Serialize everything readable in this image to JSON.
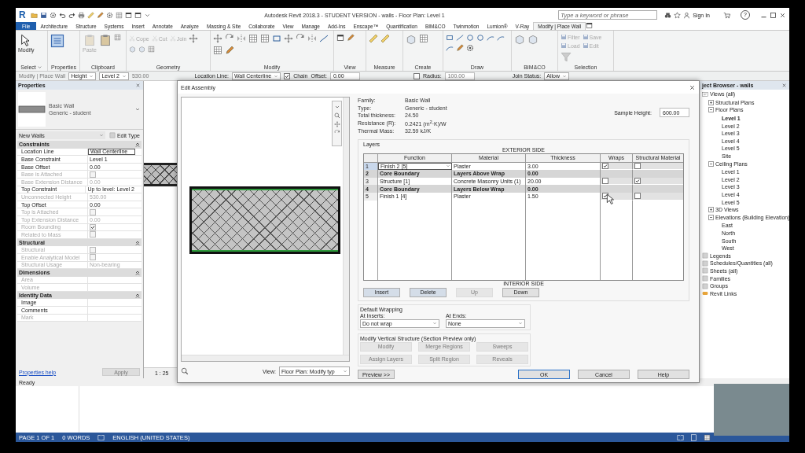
{
  "app": {
    "logo": "R",
    "title": "Autodesk Revit 2018.3 - STUDENT VERSION -   walls - Floor Plan: Level 1",
    "search": {
      "placeholder": "Type a keyword or phrase"
    },
    "sign_in": "Sign In",
    "help": "?"
  },
  "ribbon_tabs": [
    {
      "label": "File",
      "selected": false,
      "kind": "file"
    },
    {
      "label": "Architecture",
      "selected": false,
      "kind": "tab"
    },
    {
      "label": "Structure",
      "selected": false,
      "kind": "tab"
    },
    {
      "label": "Systems",
      "selected": false,
      "kind": "tab"
    },
    {
      "label": "Insert",
      "selected": false,
      "kind": "tab"
    },
    {
      "label": "Annotate",
      "selected": false,
      "kind": "tab"
    },
    {
      "label": "Analyze",
      "selected": false,
      "kind": "tab"
    },
    {
      "label": "Massing & Site",
      "selected": false,
      "kind": "tab"
    },
    {
      "label": "Collaborate",
      "selected": false,
      "kind": "tab"
    },
    {
      "label": "View",
      "selected": false,
      "kind": "tab"
    },
    {
      "label": "Manage",
      "selected": false,
      "kind": "tab"
    },
    {
      "label": "Add-Ins",
      "selected": false,
      "kind": "tab"
    },
    {
      "label": "Enscape™",
      "selected": false,
      "kind": "tab"
    },
    {
      "label": "Quantification",
      "selected": false,
      "kind": "tab"
    },
    {
      "label": "BIM&CO",
      "selected": false,
      "kind": "tab"
    },
    {
      "label": "Twinmotion",
      "selected": false,
      "kind": "tab"
    },
    {
      "label": "Lumion®",
      "selected": false,
      "kind": "tab"
    },
    {
      "label": "V-Ray",
      "selected": false,
      "kind": "tab"
    },
    {
      "label": "Modify | Place Wall",
      "selected": true,
      "kind": "tab"
    }
  ],
  "ribbon_panels": [
    {
      "label": "Select",
      "dropdown": true,
      "tools": [
        {
          "label": "Modify",
          "disabled": false
        }
      ]
    },
    {
      "label": "Properties",
      "dropdown": false
    },
    {
      "label": "Clipboard",
      "dropdown": false,
      "tools": [
        {
          "label": "Paste",
          "disabled": true
        }
      ]
    },
    {
      "label": "Geometry",
      "dropdown": false,
      "tools": [
        {
          "label": "Cope",
          "disabled": true
        },
        {
          "label": "Cut",
          "disabled": true
        },
        {
          "label": "Join",
          "disabled": true
        }
      ]
    },
    {
      "label": "Modify",
      "dropdown": false
    },
    {
      "label": "View",
      "dropdown": false
    },
    {
      "label": "Measure",
      "dropdown": false
    },
    {
      "label": "Create",
      "dropdown": false
    },
    {
      "label": "Draw",
      "dropdown": false
    },
    {
      "label": "BIM&CO",
      "dropdown": false
    },
    {
      "label": "Selection",
      "dropdown": false,
      "tools": [
        {
          "label": "Filter",
          "disabled": true
        },
        {
          "label": "Save",
          "disabled": true
        },
        {
          "label": "Load",
          "disabled": true
        },
        {
          "label": "Edit",
          "disabled": true
        }
      ]
    }
  ],
  "options_bar": {
    "mode": "Modify | Place Wall",
    "height_mode": "Height",
    "level": "Level 2",
    "height_value": "530.00",
    "location_label": "Location Line:",
    "location_value": "Wall Centerline",
    "chain": {
      "label": "Chain",
      "checked": true
    },
    "offset_label": "Offset:",
    "offset_value": "0.00",
    "radius": {
      "label": "Radius:",
      "checked": false,
      "value": "100.00"
    },
    "join_label": "Join Status:",
    "join_value": "Allow"
  },
  "properties": {
    "title": "Properties",
    "type_name": "Basic Wall",
    "type_sub": "Generic - student",
    "instance": "New Walls",
    "edit_type": "Edit Type",
    "groups": [
      {
        "title": "Constraints",
        "expanded": true,
        "rows": [
          {
            "label": "Location Line",
            "kind": "text",
            "value": "Wall Centerline",
            "disabled": false,
            "selected": true
          },
          {
            "label": "Base Constraint",
            "kind": "text",
            "value": "Level 1",
            "disabled": false,
            "selected": false
          },
          {
            "label": "Base Offset",
            "kind": "text",
            "value": "0.00",
            "disabled": false,
            "selected": false
          },
          {
            "label": "Base is Attached",
            "kind": "checkbox",
            "checked": false,
            "disabled": true,
            "selected": false
          },
          {
            "label": "Base Extension Distance",
            "kind": "text",
            "value": "0.00",
            "disabled": true,
            "selected": false
          },
          {
            "label": "Top Constraint",
            "kind": "text",
            "value": "Up to level: Level 2",
            "disabled": false,
            "selected": false
          },
          {
            "label": "Unconnected Height",
            "kind": "text",
            "value": "530.00",
            "disabled": true,
            "selected": false
          },
          {
            "label": "Top Offset",
            "kind": "text",
            "value": "0.00",
            "disabled": false,
            "selected": false
          },
          {
            "label": "Top is Attached",
            "kind": "checkbox",
            "checked": false,
            "disabled": true,
            "selected": false
          },
          {
            "label": "Top Extension Distance",
            "kind": "text",
            "value": "0.00",
            "disabled": true,
            "selected": false
          },
          {
            "label": "Room Bounding",
            "kind": "checkbox",
            "checked": true,
            "disabled": true,
            "selected": false
          },
          {
            "label": "Related to Mass",
            "kind": "checkbox",
            "checked": false,
            "disabled": true,
            "selected": false
          }
        ]
      },
      {
        "title": "Structural",
        "expanded": true,
        "rows": [
          {
            "label": "Structural",
            "kind": "checkbox",
            "checked": false,
            "disabled": true,
            "selected": false
          },
          {
            "label": "Enable Analytical Model",
            "kind": "checkbox",
            "checked": false,
            "disabled": true,
            "selected": false
          },
          {
            "label": "Structural Usage",
            "kind": "text",
            "value": "Non-bearing",
            "disabled": true,
            "selected": false
          }
        ]
      },
      {
        "title": "Dimensions",
        "expanded": true,
        "rows": [
          {
            "label": "Area",
            "kind": "text",
            "disabled": true,
            "selected": false
          },
          {
            "label": "Volume",
            "kind": "text",
            "disabled": true,
            "selected": false
          }
        ]
      },
      {
        "title": "Identity Data",
        "expanded": true,
        "rows": [
          {
            "label": "Image",
            "kind": "text",
            "disabled": false,
            "selected": false
          },
          {
            "label": "Comments",
            "kind": "text",
            "disabled": false,
            "selected": false
          },
          {
            "label": "Mark",
            "kind": "text",
            "disabled": true,
            "selected": false
          }
        ]
      }
    ],
    "help_link": "Properties help",
    "apply": {
      "label": "Apply",
      "disabled": true
    }
  },
  "view_bar": {
    "scale": "1 : 25"
  },
  "project_browser": {
    "title": "ject Browser - walls",
    "tree": [
      {
        "label": "Views (all)",
        "selected": false,
        "children": [
          {
            "label": "Structural Plans",
            "expanded": false,
            "selected": false
          },
          {
            "label": "Floor Plans",
            "expanded": true,
            "selected": false,
            "children": [
              {
                "label": "Level 1",
                "selected": true
              },
              {
                "label": "Level 2",
                "selected": false
              },
              {
                "label": "Level 3",
                "selected": false
              },
              {
                "label": "Level 4",
                "selected": false
              },
              {
                "label": "Level 5",
                "selected": false
              },
              {
                "label": "Site",
                "selected": false
              }
            ]
          },
          {
            "label": "Ceiling Plans",
            "expanded": true,
            "selected": false,
            "children": [
              {
                "label": "Level 1",
                "selected": false
              },
              {
                "label": "Level 2",
                "selected": false
              },
              {
                "label": "Level 3",
                "selected": false
              },
              {
                "label": "Level 4",
                "selected": false
              },
              {
                "label": "Level 5",
                "selected": false
              }
            ]
          },
          {
            "label": "3D Views",
            "expanded": false,
            "selected": false
          },
          {
            "label": "Elevations (Building Elevation)",
            "expanded": true,
            "selected": false,
            "children": [
              {
                "label": "East",
                "selected": false
              },
              {
                "label": "North",
                "selected": false
              },
              {
                "label": "South",
                "selected": false
              },
              {
                "label": "West",
                "selected": false
              }
            ]
          }
        ]
      },
      {
        "label": "Legends",
        "selected": false
      },
      {
        "label": "Schedules/Quantities (all)",
        "selected": false
      },
      {
        "label": "Sheets (all)",
        "selected": false
      },
      {
        "label": "Families",
        "selected": false
      },
      {
        "label": "Groups",
        "selected": false
      },
      {
        "label": "Revit Links",
        "selected": false
      }
    ]
  },
  "status": "Ready",
  "dialog": {
    "title": "Edit Assembly",
    "info": [
      {
        "label": "Family:",
        "value": "Basic Wall"
      },
      {
        "label": "Type:",
        "value": "Generic - student"
      },
      {
        "label": "Total thickness:",
        "value": "24.50"
      },
      {
        "label": "Resistance (R):",
        "value": "0.2421 (m$^{2}$·K)/W"
      },
      {
        "label": "Thermal Mass:",
        "value": "32.59 kJ/K"
      }
    ],
    "sample_height": {
      "label": "Sample Height:",
      "value": "600.00"
    },
    "layers": {
      "title": "Layers",
      "top_label": "EXTERIOR SIDE",
      "bottom_label": "INTERIOR SIDE",
      "columns": [
        "Function",
        "Material",
        "Thickness",
        "Wraps",
        "Structural Material"
      ],
      "rows": [
        {
          "number": "1",
          "kind": "layer",
          "function": "Finish 2 [5]",
          "material": "Plaster",
          "thickness": "3.00",
          "wraps": true,
          "structural": false,
          "selected": true
        },
        {
          "number": "2",
          "kind": "boundary",
          "function": "Core Boundary",
          "material": "Layers Above Wrap",
          "thickness": "0.00",
          "selected": false
        },
        {
          "number": "3",
          "kind": "layer",
          "function": "Structure [1]",
          "material": "Concrete Masonry Units (1)",
          "thickness": "20.00",
          "wraps": false,
          "structural": true,
          "selected": false
        },
        {
          "number": "4",
          "kind": "boundary",
          "function": "Core Boundary",
          "material": "Layers Below Wrap",
          "thickness": "0.00",
          "selected": false
        },
        {
          "number": "5",
          "kind": "layer",
          "function": "Finish 1 [4]",
          "material": "Plaster",
          "thickness": "1.50",
          "wraps": true,
          "structural": false,
          "selected": false
        }
      ],
      "buttons": [
        {
          "label": "Insert",
          "disabled": false
        },
        {
          "label": "Delete",
          "disabled": false
        },
        {
          "label": "Up",
          "disabled": true
        },
        {
          "label": "Down",
          "disabled": false
        }
      ]
    },
    "wrapping": {
      "title": "Default Wrapping",
      "inserts_label": "At Inserts:",
      "inserts_value": "Do not wrap",
      "ends_label": "At Ends:",
      "ends_value": "None"
    },
    "vertical": {
      "title": "Modify Vertical Structure (Section Preview only)",
      "buttons": [
        {
          "label": "Modify",
          "disabled": true
        },
        {
          "label": "Merge Regions",
          "disabled": true
        },
        {
          "label": "Sweeps",
          "disabled": true
        },
        {
          "label": "Assign Layers",
          "disabled": true
        },
        {
          "label": "Split Region",
          "disabled": true
        },
        {
          "label": "Reveals",
          "disabled": true
        }
      ]
    },
    "view_label": "View:",
    "view_value": "Floor Plan: Modify typ",
    "preview_button": "Preview >>",
    "actions": [
      {
        "label": "OK",
        "default": true
      },
      {
        "label": "Cancel",
        "default": false
      },
      {
        "label": "Help",
        "default": false
      }
    ]
  },
  "word_status": {
    "page": "PAGE 1 OF 1",
    "words": "0 WORDS",
    "language": "ENGLISH (UNITED STATES)"
  }
}
